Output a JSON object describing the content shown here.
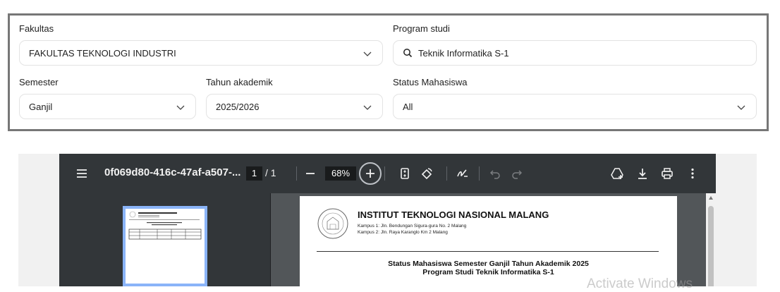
{
  "filters": {
    "fakultas": {
      "label": "Fakultas",
      "value": "FAKULTAS TEKNOLOGI INDUSTRI"
    },
    "program_studi": {
      "label": "Program studi",
      "value": "Teknik Informatika S-1"
    },
    "semester": {
      "label": "Semester",
      "value": "Ganjil"
    },
    "tahun_akademik": {
      "label": "Tahun akademik",
      "value": "2025/2026"
    },
    "status_mahasiswa": {
      "label": "Status Mahasiswa",
      "value": "All"
    }
  },
  "pdf_viewer": {
    "doc_title": "0f069d80-416c-47af-a507-...",
    "current_page": "1",
    "page_total": "/ 1",
    "zoom": "68%",
    "page": {
      "institution": "INSTITUT TEKNOLOGI NASIONAL MALANG",
      "campus1": "Kampus 1: Jln. Bendungan Sigura-gura No. 2 Malang",
      "campus2": "Kampus 2: Jln. Raya Karanglo Km 2 Malang",
      "heading1": "Status Mahasiswa Semester Ganjil Tahun Akademik 2025",
      "heading2": "Program Studi Teknik Informatika S-1"
    }
  },
  "watermark": "Activate Windows",
  "colors": {
    "toolbar": "#323639",
    "viewer_bg": "#525659",
    "thumb_border": "#8ab4f8"
  }
}
